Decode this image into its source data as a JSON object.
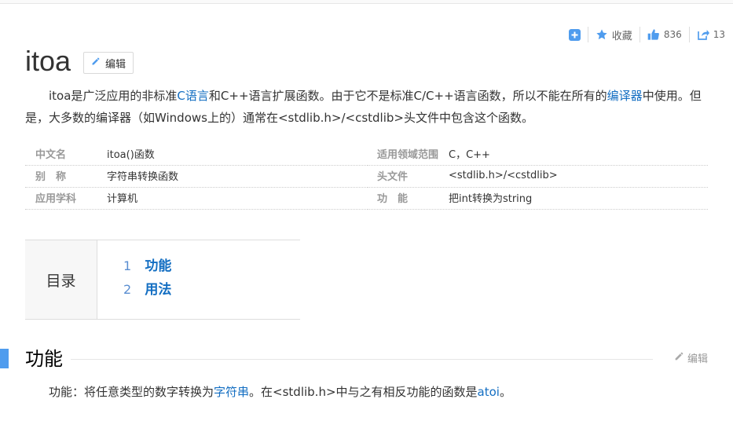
{
  "toolbar": {
    "add_icon": "plus-square-icon",
    "collect_label": "收藏",
    "like_count": "836",
    "share_count": "13",
    "accent": "#4f9cee"
  },
  "title": "itoa",
  "edit_label": "编辑",
  "summary": {
    "part1": "itoa是广泛应用的非标准",
    "link1": "C语言",
    "part2": "和C++语言扩展函数。由于它不是标准C/C++语言函数，所以不能在所有的",
    "link2": "编译器",
    "part3": "中使用。但是，大多数的编译器（如Windows上的）通常在<stdlib.h>/<cstdlib>头文件中包含这个函数。"
  },
  "info": [
    {
      "k1": "中文名",
      "v1": "itoa()函数",
      "k2": "适用领域范围",
      "v2": "C，C++"
    },
    {
      "k1": "别　称",
      "v1": "字符串转换函数",
      "k2": "头文件",
      "v2": "<stdlib.h>/<cstdlib>"
    },
    {
      "k1": "应用学科",
      "v1": "计算机",
      "k2": "功　能",
      "v2": "把int转换为string"
    }
  ],
  "toc": {
    "label": "目录",
    "items": [
      {
        "num": "1",
        "text": "功能"
      },
      {
        "num": "2",
        "text": "用法"
      }
    ]
  },
  "section": {
    "title": "功能",
    "edit_label": "编辑",
    "body_part1": "功能：将任意类型的数字转换为",
    "body_link1": "字符串",
    "body_part2": "。在<stdlib.h>中与之有相反功能的函数是",
    "body_link2": "atoi",
    "body_part3": "。"
  }
}
